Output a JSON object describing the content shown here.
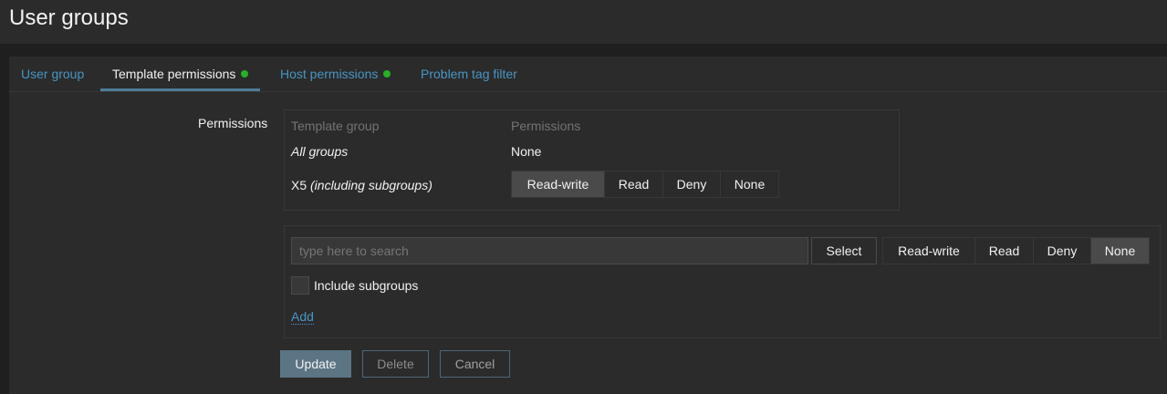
{
  "header": {
    "title": "User groups"
  },
  "tabs": [
    {
      "label": "User group",
      "active": false,
      "dot": false
    },
    {
      "label": "Template permissions",
      "active": true,
      "dot": true
    },
    {
      "label": "Host permissions",
      "active": false,
      "dot": true
    },
    {
      "label": "Problem tag filter",
      "active": false,
      "dot": false
    }
  ],
  "form": {
    "permissions_label": "Permissions",
    "table": {
      "columns": [
        "Template group",
        "Permissions"
      ],
      "rows": [
        {
          "group": "All groups",
          "group_suffix": "",
          "permission_text": "None"
        },
        {
          "group": "X5",
          "group_suffix": "(including subgroups)",
          "options": [
            "Read-write",
            "Read",
            "Deny",
            "None"
          ],
          "selected": "Read-write"
        }
      ]
    },
    "add": {
      "search_placeholder": "type here to search",
      "select_label": "Select",
      "options": [
        "Read-write",
        "Read",
        "Deny",
        "None"
      ],
      "selected": "None",
      "include_subgroups_label": "Include subgroups",
      "include_subgroups_checked": false,
      "add_link": "Add"
    },
    "buttons": {
      "update": "Update",
      "delete": "Delete",
      "cancel": "Cancel"
    }
  },
  "colors": {
    "accent": "#4796c4",
    "status_dot": "#26b126",
    "primary_button": "#5b7585"
  }
}
